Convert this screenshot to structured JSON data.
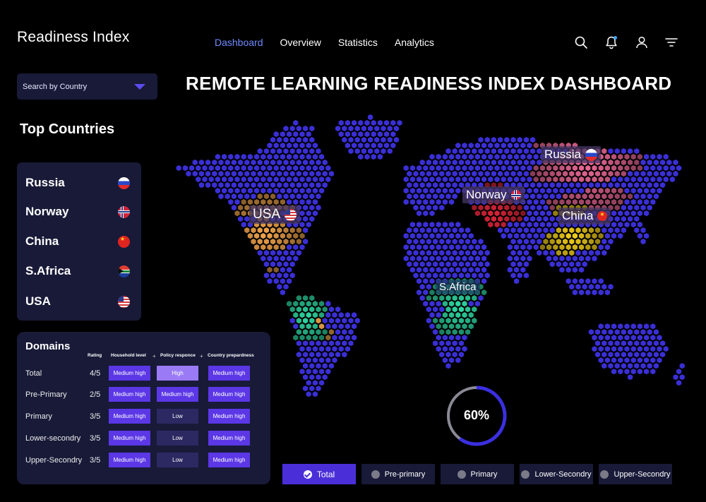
{
  "app": {
    "title": "Readiness Index"
  },
  "nav": [
    {
      "label": "Dashboard",
      "active": true
    },
    {
      "label": "Overview"
    },
    {
      "label": "Statistics"
    },
    {
      "label": "Analytics"
    }
  ],
  "header_icons": [
    "search-icon",
    "bell-icon",
    "user-icon",
    "filter-icon"
  ],
  "search": {
    "label": "Search by Country"
  },
  "page_title": "REMOTE LEARNING READINESS INDEX DASHBOARD",
  "top_countries": {
    "title": "Top Countries",
    "items": [
      {
        "name": "Russia",
        "flag": "russia-flag-icon"
      },
      {
        "name": "Norway",
        "flag": "norway-flag-icon"
      },
      {
        "name": "China",
        "flag": "china-flag-icon"
      },
      {
        "name": "S.Africa",
        "flag": "south-africa-flag-icon"
      },
      {
        "name": "USA",
        "flag": "usa-flag-icon"
      }
    ]
  },
  "domains": {
    "title": "Domains",
    "headers": [
      "Rating",
      "Household level",
      "Policy responce",
      "Country prepardness"
    ],
    "rows": [
      {
        "label": "Total",
        "rating": "4/5",
        "household": "Medium high",
        "policy": "High",
        "country": "Medium high"
      },
      {
        "label": "Pre-Primary",
        "rating": "2/5",
        "household": "Medium high",
        "policy": "Medium high",
        "country": "Medium high"
      },
      {
        "label": "Primary",
        "rating": "3/5",
        "household": "Medium high",
        "policy": "Low",
        "country": "Medium high"
      },
      {
        "label": "Lower-secondry",
        "rating": "3/5",
        "household": "Medium high",
        "policy": "Low",
        "country": "Medium high"
      },
      {
        "label": "Upper-Secondry",
        "rating": "3/5",
        "household": "Medium high",
        "policy": "Low",
        "country": "Medium high"
      }
    ]
  },
  "map_labels": {
    "russia": "Russia",
    "norway": "Norway",
    "usa": "USA",
    "china": "China",
    "safrica": "S.Africa"
  },
  "gauge": {
    "value": 0.6,
    "label": "60%"
  },
  "filters": [
    {
      "label": "Total",
      "active": true
    },
    {
      "label": "Pre-primary"
    },
    {
      "label": "Primary"
    },
    {
      "label": "Lower-Secondry"
    },
    {
      "label": "Upper-Secondry"
    }
  ],
  "colors": {
    "land": "#3a2fd6",
    "accent": "#5b37e6",
    "usa": "#f5a74c",
    "norway": "#e0243a",
    "russia": "#f06a9a",
    "china": "#f7d31a",
    "safrica": "#2ee0a8"
  }
}
